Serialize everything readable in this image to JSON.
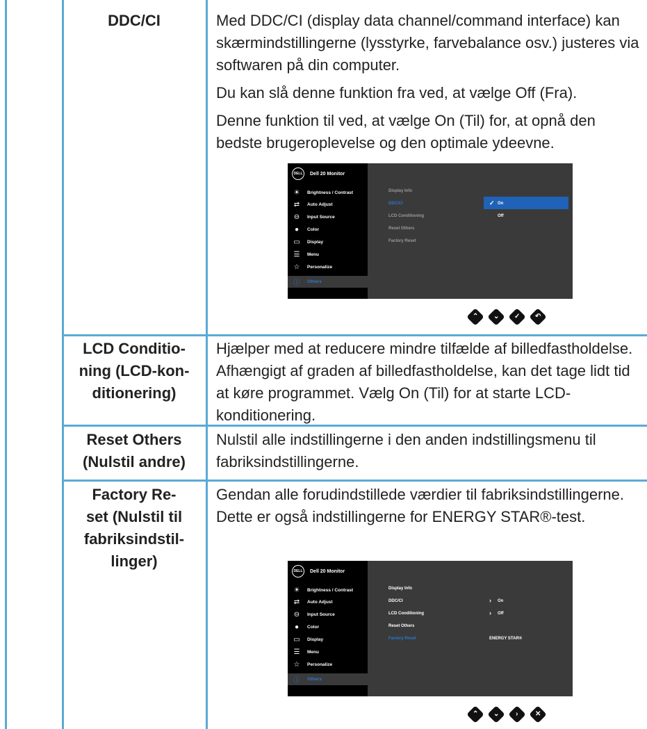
{
  "rows": [
    {
      "term": "DDC/CI",
      "paragraphs": [
        "Med DDC/CI (display data channel/command interface) kan skærmindstillingerne (lysstyrke, farvebalance osv.) justeres via softwaren på din computer.",
        "Du kan slå denne funktion fra ved, at vælge Off (Fra).",
        "Denne funktion til ved, at vælge On (Til) for, at opnå den bedste brugeroplevelse og den optimale ydeevne."
      ]
    },
    {
      "term_lines": [
        "LCD Conditio-",
        "ning (LCD-kon-",
        "ditionering)"
      ],
      "text": "Hjælper med at reducere mindre tilfælde af billedfastholdelse. Afhængigt af graden af billedfastholdelse, kan det tage lidt tid at køre programmet. Vælg On (Til) for at starte LCD-konditionering."
    },
    {
      "term_lines": [
        "Reset Others",
        "(Nulstil andre)"
      ],
      "text": "Nulstil alle indstillingerne i den anden indstillingsmenu til fabriksindstillingerne."
    },
    {
      "term_lines": [
        "Factory Re-",
        "set (Nulstil til",
        "fabriksindstil-",
        "linger)"
      ],
      "text": "Gendan alle forudindstillede værdier til fabriksindstillingerne. Dette er også indstillingerne for ENERGY STAR®-test."
    }
  ],
  "osd": {
    "logo": "DELL",
    "title": "Dell 20 Monitor",
    "menu": [
      "Brightness / Contrast",
      "Auto Adjust",
      "Input Source",
      "Color",
      "Display",
      "Menu",
      "Personalize",
      "Others"
    ],
    "sub": [
      "Display Info",
      "DDC/CI",
      "LCD Conditioning",
      "Reset Others",
      "Factory Reset"
    ],
    "osd1": {
      "on": "On",
      "off": "Off"
    },
    "osd2": {
      "ddc": "On",
      "lcd": "Off",
      "energy": "ENERGY STAR®"
    }
  },
  "colors": {
    "rule": "#5aa9d6",
    "osd_bg": "#3a3a3a",
    "highlight": "#1f62b8"
  }
}
